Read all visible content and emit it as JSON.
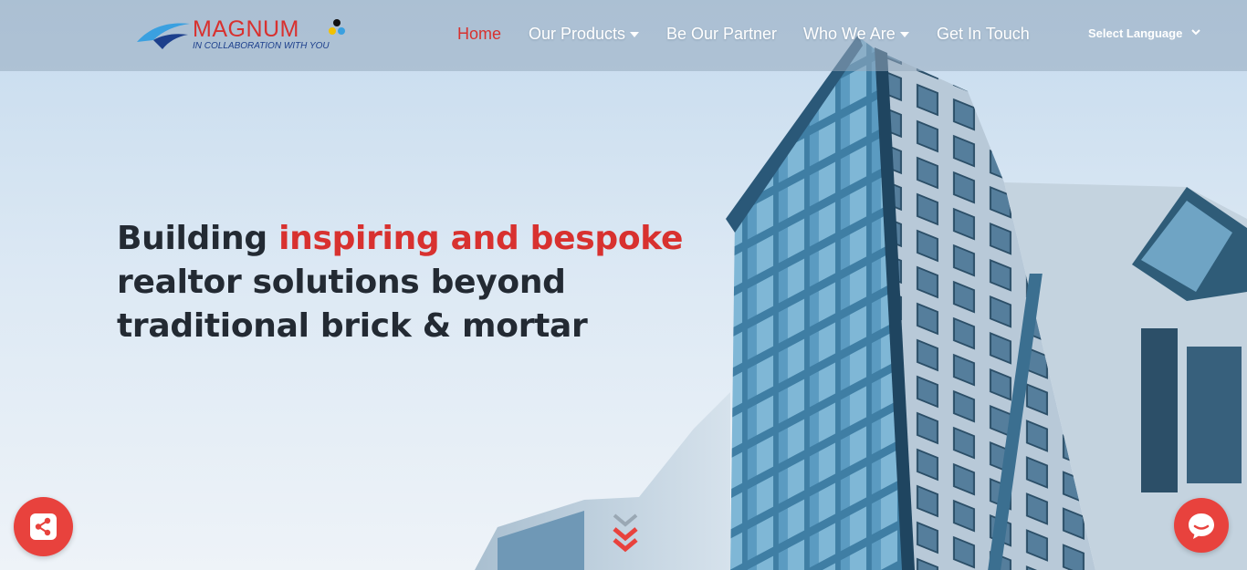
{
  "brand": {
    "name": "MAGNUM",
    "tagline": "IN COLLABORATION WITH YOU",
    "colors": {
      "red": "#d8312f",
      "blue": "#1c3f8c",
      "sky": "#3aa0e0",
      "yellow": "#f2c100",
      "black": "#111111"
    }
  },
  "nav": {
    "items": [
      {
        "label": "Home",
        "active": true,
        "dropdown": false
      },
      {
        "label": "Our Products",
        "active": false,
        "dropdown": true
      },
      {
        "label": "Be Our Partner",
        "active": false,
        "dropdown": false
      },
      {
        "label": "Who We Are",
        "active": false,
        "dropdown": true
      },
      {
        "label": "Get In Touch",
        "active": false,
        "dropdown": false
      }
    ],
    "language_select": "Select Language"
  },
  "hero": {
    "headline_part1": "Building ",
    "headline_highlight": "inspiring and bespoke",
    "headline_part2": " realtor solutions beyond traditional brick & mortar"
  },
  "icons": {
    "share": "share-icon",
    "chat": "chat-icon",
    "scroll": "double-chevron-down-icon",
    "dropdown": "caret-down-icon",
    "chevron": "chevron-down-icon"
  },
  "accent_color": "#e8423d"
}
